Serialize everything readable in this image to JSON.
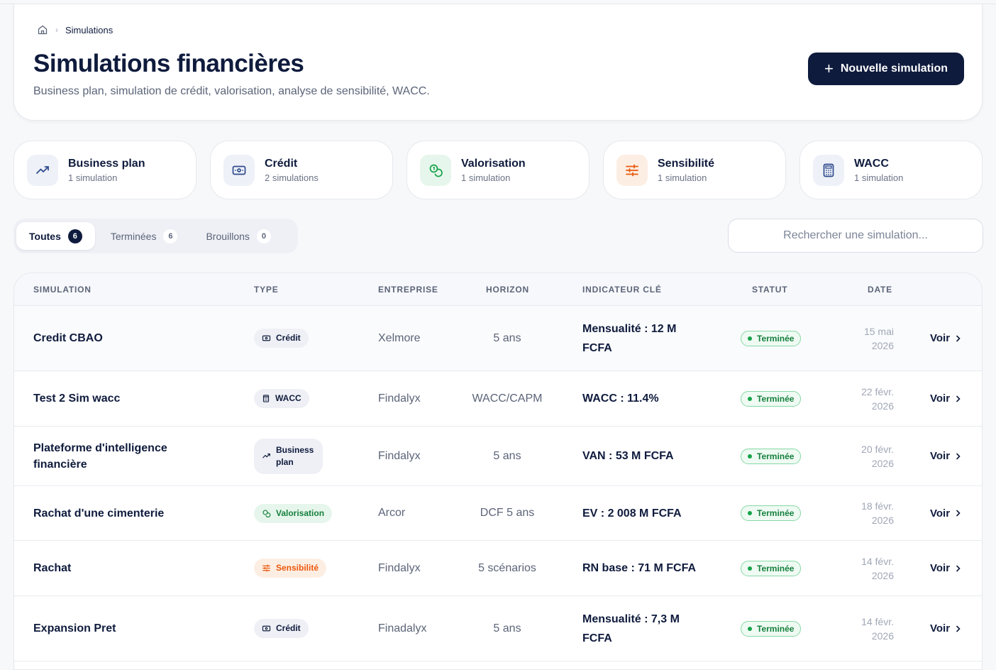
{
  "breadcrumb": {
    "current": "Simulations"
  },
  "header": {
    "title": "Simulations financières",
    "subtitle": "Business plan, simulation de crédit, valorisation, analyse de sensibilité, WACC.",
    "new_button_label": "Nouvelle simulation"
  },
  "type_cards": [
    {
      "title": "Business plan",
      "count": "1 simulation",
      "icon": "trend-icon",
      "color": "#2f4b8c",
      "bg": "#eef1f8"
    },
    {
      "title": "Crédit",
      "count": "2 simulations",
      "icon": "banknote-icon",
      "color": "#2f4b8c",
      "bg": "#eef1f8"
    },
    {
      "title": "Valorisation",
      "count": "1 simulation",
      "icon": "coins-icon",
      "color": "#16a34a",
      "bg": "#e7f6ec"
    },
    {
      "title": "Sensibilité",
      "count": "1 simulation",
      "icon": "sliders-icon",
      "color": "#ea580c",
      "bg": "#fdeee3"
    },
    {
      "title": "WACC",
      "count": "1 simulation",
      "icon": "calculator-icon",
      "color": "#2f4b8c",
      "bg": "#eef1f8"
    }
  ],
  "filters": [
    {
      "label": "Toutes",
      "count": "6",
      "active": true
    },
    {
      "label": "Terminées",
      "count": "6",
      "active": false
    },
    {
      "label": "Brouillons",
      "count": "0",
      "active": false
    }
  ],
  "search": {
    "placeholder": "Rechercher une simulation..."
  },
  "table": {
    "headers": {
      "simulation": "SIMULATION",
      "type": "TYPE",
      "entreprise": "ENTREPRISE",
      "horizon": "HORIZON",
      "indicateur": "INDICATEUR CLÉ",
      "statut": "STATUT",
      "date": "DATE"
    },
    "rows": [
      {
        "name": "Credit CBAO",
        "type": "Crédit",
        "entreprise": "Xelmore",
        "horizon": "5 ans",
        "indicator": "Mensualité : 12 M FCFA",
        "status": "Terminée",
        "date_day": "15 mai",
        "date_year": "2026",
        "action": "Voir"
      },
      {
        "name": "Test 2 Sim wacc",
        "type": "WACC",
        "entreprise": "Findalyx",
        "horizon": "WACC/CAPM",
        "indicator": "WACC : 11.4%",
        "status": "Terminée",
        "date_day": "22 févr.",
        "date_year": "2026",
        "action": "Voir"
      },
      {
        "name": "Plateforme d'intelligence financière",
        "type": "Business plan",
        "entreprise": "Findalyx",
        "horizon": "5 ans",
        "indicator": "VAN : 53 M FCFA",
        "status": "Terminée",
        "date_day": "20 févr.",
        "date_year": "2026",
        "action": "Voir"
      },
      {
        "name": "Rachat d'une cimenterie",
        "type": "Valorisation",
        "entreprise": "Arcor",
        "horizon": "DCF 5 ans",
        "indicator": "EV : 2 008 M FCFA",
        "status": "Terminée",
        "date_day": "18 févr.",
        "date_year": "2026",
        "action": "Voir"
      },
      {
        "name": "Rachat",
        "type": "Sensibilité",
        "entreprise": "Findalyx",
        "horizon": "5 scénarios",
        "indicator": "RN base : 71 M FCFA",
        "status": "Terminée",
        "date_day": "14 févr.",
        "date_year": "2026",
        "action": "Voir"
      },
      {
        "name": "Expansion Pret",
        "type": "Crédit",
        "entreprise": "Finadalyx",
        "horizon": "5 ans",
        "indicator": "Mensualité : 7,3 M FCFA",
        "status": "Terminée",
        "date_day": "14 févr.",
        "date_year": "2026",
        "action": "Voir"
      }
    ]
  }
}
